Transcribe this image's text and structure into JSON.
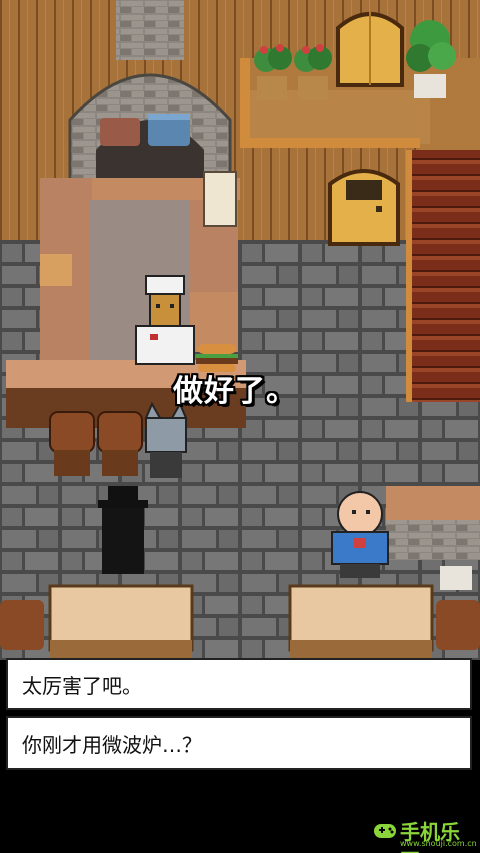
{
  "dialogue": {
    "npc_line": "做好了。",
    "choices": [
      {
        "label": "太厉害了吧。"
      },
      {
        "label": "你刚才用微波炉…？"
      }
    ]
  },
  "watermark": {
    "brand": "手机乐园",
    "url": "www.shouji.com.cn"
  },
  "colors": {
    "wall_wood": "#a8733a",
    "stone_floor": "#6e6e6e",
    "choice_bg": "#ffffff",
    "speech_text": "#ffffff",
    "watermark": "#8ad53a"
  }
}
